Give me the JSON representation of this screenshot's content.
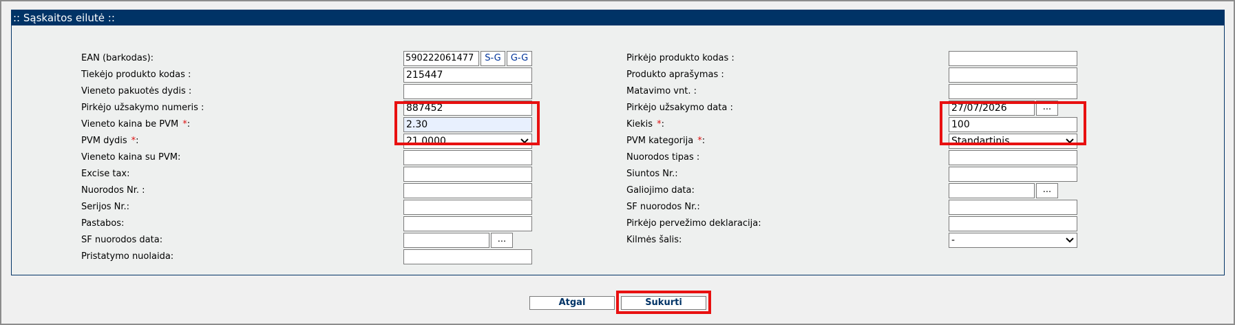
{
  "panel": {
    "title": ":: Sąskaitos eilutė ::"
  },
  "left": {
    "ean_label": "EAN (barkodas):",
    "ean_value": "590222061477",
    "ean_btn_sg": "S-G",
    "ean_btn_gg": "G-G",
    "supplier_code_label": "Tiekėjo produkto kodas :",
    "supplier_code_value": "215447",
    "pack_size_label": "Vieneto pakuotės dydis :",
    "order_no_label": "Pirkėjo užsakymo numeris :",
    "order_no_value": "887452",
    "unit_price_label": "Vieneto kaina be PVM",
    "unit_price_value": "2.30",
    "vat_rate_label": "PVM dydis",
    "vat_rate_value": "21.0000",
    "unit_price_vat_label": "Vieneto kaina su PVM:",
    "excise_label": "Excise tax:",
    "ref_no_label": "Nuorodos Nr. :",
    "serial_label": "Serijos Nr.:",
    "notes_label": "Pastabos:",
    "sf_ref_date_label": "SF nuorodos data:",
    "discount_label": "Pristatymo nuolaida:"
  },
  "right": {
    "buyer_code_label": "Pirkėjo produkto kodas :",
    "description_label": "Produkto aprašymas :",
    "unit_label": "Matavimo vnt. :",
    "order_date_label": "Pirkėjo užsakymo data :",
    "order_date_value": "27/07/2026",
    "quantity_label": "Kiekis",
    "quantity_value": "100",
    "vat_category_label": "PVM kategorija",
    "vat_category_value": "Standartinis",
    "ref_type_label": "Nuorodos tipas :",
    "shipment_label": "Siuntos Nr.:",
    "expiry_label": "Galiojimo data:",
    "sf_ref_no_label": "SF nuorodos Nr.:",
    "transport_decl_label": "Pirkėjo pervežimo deklaracija:",
    "origin_label": "Kilmės šalis:",
    "origin_value": "-"
  },
  "common": {
    "required_mark": "*",
    "colon": ":",
    "dots_label": "..."
  },
  "buttons": {
    "back_label": "Atgal",
    "create_label": "Sukurti"
  },
  "colors": {
    "header_bg": "#003366",
    "required": "#d11",
    "highlight": "#e81010"
  }
}
